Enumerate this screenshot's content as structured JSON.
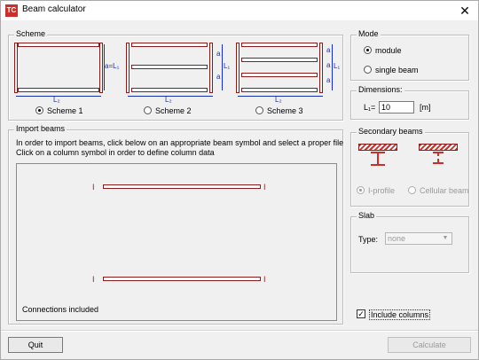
{
  "window": {
    "title": "Beam calculator",
    "icon": "app-logo-icon",
    "close": "✕"
  },
  "scheme": {
    "legend": "Scheme",
    "options": [
      {
        "label": "Scheme 1",
        "selected": true
      },
      {
        "label": "Scheme 2",
        "selected": false
      },
      {
        "label": "Scheme 3",
        "selected": false
      }
    ],
    "dims": {
      "a_l1": "a=L₁",
      "l1": "L₁",
      "l2": "L₂",
      "a": "a"
    }
  },
  "mode": {
    "legend": "Mode",
    "options": [
      {
        "label": "module",
        "selected": true
      },
      {
        "label": "single beam",
        "selected": false
      }
    ]
  },
  "dimensions": {
    "legend": "Dimensions:",
    "label": "L₁=",
    "value": "10",
    "unit": "[m]"
  },
  "import": {
    "legend": "Import beams",
    "line1": "In order to import beams, click below on an appropriate beam symbol and select a proper file",
    "line2": "Click on a column symbol in order to define column data",
    "connections": "Connections included"
  },
  "secondary": {
    "legend": "Secondary beams",
    "options": [
      {
        "label": "I-profile",
        "selected": true
      },
      {
        "label": "Cellular beam",
        "selected": false
      }
    ]
  },
  "slab": {
    "legend": "Slab",
    "type_label": "Type:",
    "type_value": "none"
  },
  "include_columns": {
    "label": "Include columns",
    "checked": true
  },
  "buttons": {
    "quit": "Quit",
    "calculate": "Calculate"
  },
  "colors": {
    "beam": "#8b1a1a",
    "dimension": "#1a2fb0",
    "accent": "#c8302a"
  }
}
